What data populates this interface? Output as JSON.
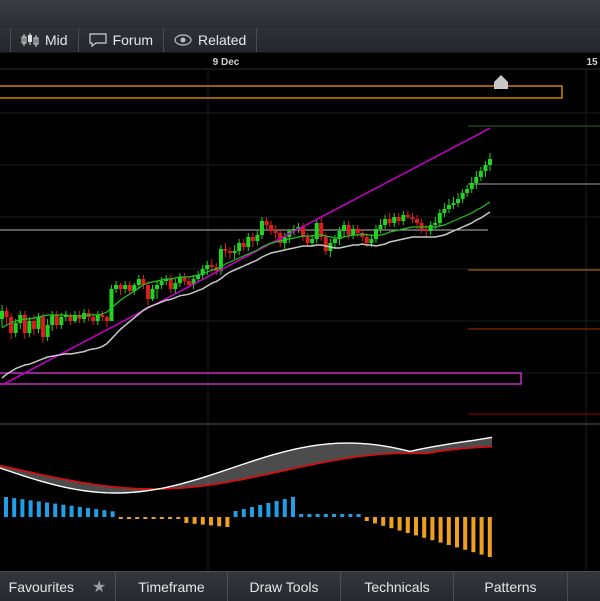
{
  "toolbar": {
    "mid_label": "Mid",
    "forum_label": "Forum",
    "related_label": "Related"
  },
  "icons": {
    "mid": "candlestick-icon",
    "forum": "speech-bubble-icon",
    "related": "eye-icon",
    "favourites": "star-icon",
    "alert": "house-marker-icon"
  },
  "x_axis": {
    "labels": [
      "9 Dec",
      "15"
    ]
  },
  "bottom": {
    "favourites_label": "Favourites",
    "timeframe_label": "Timeframe",
    "draw_tools_label": "Draw Tools",
    "technicals_label": "Technicals",
    "patterns_label": "Patterns"
  },
  "colors": {
    "up": "#22d422",
    "down": "#e01b1b",
    "ema_fast": "#22c322",
    "ema_mid": "#c8c8c8",
    "ema_slow": "#c000c0",
    "orange_zone": "#e08a00",
    "magenta_zone": "#cc33cc",
    "hist_pos": "#1e9fe6",
    "hist_neg": "#f0a020"
  },
  "chart_data": {
    "type": "candlestick",
    "candles": [
      [
        266,
        258,
        274,
        252
      ],
      [
        258,
        264,
        272,
        254
      ],
      [
        264,
        280,
        286,
        260
      ],
      [
        280,
        270,
        284,
        266
      ],
      [
        270,
        262,
        276,
        258
      ],
      [
        262,
        280,
        286,
        258
      ],
      [
        280,
        268,
        284,
        264
      ],
      [
        268,
        276,
        282,
        262
      ],
      [
        276,
        264,
        280,
        260
      ],
      [
        264,
        284,
        290,
        260
      ],
      [
        284,
        272,
        288,
        266
      ],
      [
        272,
        262,
        278,
        258
      ],
      [
        262,
        272,
        276,
        258
      ],
      [
        272,
        264,
        276,
        260
      ],
      [
        264,
        262,
        268,
        258
      ],
      [
        262,
        268,
        272,
        260
      ],
      [
        268,
        262,
        270,
        258
      ],
      [
        262,
        266,
        270,
        258
      ],
      [
        266,
        260,
        270,
        256
      ],
      [
        260,
        264,
        268,
        256
      ],
      [
        264,
        268,
        272,
        260
      ],
      [
        268,
        262,
        272,
        258
      ],
      [
        262,
        264,
        268,
        258
      ],
      [
        264,
        268,
        274,
        262
      ],
      [
        268,
        236,
        240,
        232
      ],
      [
        236,
        232,
        240,
        228
      ],
      [
        232,
        236,
        242,
        230
      ],
      [
        236,
        232,
        240,
        228
      ],
      [
        232,
        238,
        242,
        228
      ],
      [
        238,
        232,
        242,
        230
      ],
      [
        232,
        226,
        236,
        222
      ],
      [
        226,
        232,
        236,
        222
      ],
      [
        232,
        246,
        252,
        228
      ],
      [
        246,
        236,
        248,
        232
      ],
      [
        236,
        232,
        246,
        228
      ],
      [
        232,
        228,
        236,
        224
      ],
      [
        228,
        226,
        232,
        222
      ],
      [
        226,
        236,
        240,
        222
      ],
      [
        236,
        230,
        240,
        226
      ],
      [
        230,
        224,
        234,
        220
      ],
      [
        224,
        228,
        232,
        220
      ],
      [
        228,
        232,
        234,
        224
      ],
      [
        232,
        226,
        236,
        222
      ],
      [
        226,
        222,
        230,
        218
      ],
      [
        222,
        216,
        226,
        212
      ],
      [
        216,
        212,
        222,
        208
      ],
      [
        212,
        214,
        220,
        206
      ],
      [
        214,
        218,
        222,
        210
      ],
      [
        218,
        196,
        222,
        192
      ],
      [
        196,
        198,
        204,
        190
      ],
      [
        198,
        200,
        206,
        194
      ],
      [
        200,
        198,
        206,
        192
      ],
      [
        198,
        190,
        202,
        186
      ],
      [
        190,
        194,
        198,
        186
      ],
      [
        194,
        184,
        198,
        180
      ],
      [
        184,
        188,
        194,
        180
      ],
      [
        188,
        182,
        192,
        178
      ],
      [
        182,
        168,
        186,
        164
      ],
      [
        168,
        172,
        176,
        164
      ],
      [
        172,
        178,
        182,
        168
      ],
      [
        178,
        180,
        186,
        172
      ],
      [
        180,
        190,
        194,
        176
      ],
      [
        190,
        184,
        196,
        180
      ],
      [
        184,
        178,
        190,
        176
      ],
      [
        178,
        176,
        182,
        172
      ],
      [
        176,
        174,
        180,
        170
      ],
      [
        174,
        184,
        188,
        170
      ],
      [
        184,
        190,
        194,
        180
      ],
      [
        190,
        186,
        194,
        182
      ],
      [
        186,
        170,
        190,
        166
      ],
      [
        170,
        184,
        188,
        164
      ],
      [
        184,
        198,
        202,
        180
      ],
      [
        198,
        190,
        204,
        186
      ],
      [
        190,
        186,
        196,
        182
      ],
      [
        186,
        178,
        192,
        174
      ],
      [
        178,
        172,
        184,
        168
      ],
      [
        172,
        182,
        186,
        168
      ],
      [
        182,
        176,
        186,
        172
      ],
      [
        176,
        180,
        184,
        172
      ],
      [
        180,
        184,
        188,
        176
      ],
      [
        184,
        190,
        194,
        180
      ],
      [
        190,
        186,
        194,
        182
      ],
      [
        186,
        176,
        190,
        172
      ],
      [
        176,
        172,
        180,
        166
      ],
      [
        172,
        166,
        176,
        162
      ],
      [
        166,
        170,
        174,
        160
      ],
      [
        170,
        164,
        174,
        160
      ],
      [
        164,
        168,
        172,
        160
      ],
      [
        168,
        162,
        172,
        158
      ],
      [
        162,
        164,
        166,
        158
      ],
      [
        164,
        166,
        170,
        160
      ],
      [
        166,
        170,
        176,
        162
      ],
      [
        170,
        176,
        180,
        166
      ],
      [
        176,
        178,
        184,
        172
      ],
      [
        178,
        172,
        182,
        168
      ],
      [
        172,
        170,
        176,
        164
      ],
      [
        170,
        160,
        174,
        156
      ],
      [
        160,
        156,
        164,
        150
      ],
      [
        156,
        152,
        160,
        146
      ],
      [
        152,
        150,
        156,
        144
      ],
      [
        150,
        146,
        154,
        140
      ],
      [
        146,
        140,
        150,
        136
      ],
      [
        140,
        136,
        144,
        132
      ],
      [
        136,
        130,
        140,
        124
      ],
      [
        130,
        124,
        136,
        118
      ],
      [
        124,
        118,
        128,
        114
      ],
      [
        118,
        112,
        124,
        108
      ],
      [
        112,
        106,
        118,
        100
      ]
    ],
    "note": "",
    "ema_fast": [
      275,
      272,
      270,
      268,
      267,
      266,
      266,
      265,
      264,
      263,
      262,
      262,
      262,
      262,
      262,
      263,
      263,
      263,
      263,
      262,
      262,
      262,
      261,
      259,
      255,
      251,
      247,
      244,
      241,
      238,
      235,
      232,
      230,
      229,
      228,
      227,
      226,
      226,
      225,
      224,
      224,
      224,
      223,
      222,
      221,
      219,
      217,
      216,
      214,
      211,
      209,
      207,
      205,
      203,
      201,
      199,
      197,
      194,
      192,
      190,
      189,
      188,
      187,
      186,
      185,
      184,
      183,
      183,
      183,
      182,
      182,
      183,
      184,
      185,
      185,
      184,
      183,
      182,
      182,
      181,
      182,
      182,
      183,
      182,
      181,
      179,
      178,
      177,
      176,
      175,
      174,
      174,
      174,
      174,
      174,
      174,
      173,
      172,
      170,
      168,
      166,
      164,
      162,
      160,
      157,
      155,
      152,
      149
    ],
    "ema_slow": [
      292,
      290,
      288,
      286,
      284,
      282,
      280,
      278,
      276,
      274,
      272,
      270,
      268,
      266,
      264,
      262,
      260,
      258,
      256,
      254,
      252,
      250,
      248,
      246,
      244,
      242,
      240,
      238,
      236,
      234,
      232,
      230,
      228,
      226,
      224,
      222,
      220,
      218,
      216,
      214,
      212,
      210,
      208,
      206,
      204,
      202,
      200,
      198,
      196,
      194,
      192,
      190,
      188,
      186,
      184,
      182,
      180,
      178,
      176,
      174,
      172,
      170,
      168,
      166,
      164,
      162,
      160,
      158,
      156,
      154,
      152,
      150,
      148,
      146,
      144,
      142,
      140,
      138,
      136,
      134,
      132,
      130,
      128,
      126,
      124,
      122,
      120,
      118,
      116,
      114,
      112,
      110,
      108,
      106,
      104,
      102,
      100,
      98,
      96,
      94,
      92,
      90,
      88,
      86,
      84,
      82,
      80,
      78
    ]
  }
}
